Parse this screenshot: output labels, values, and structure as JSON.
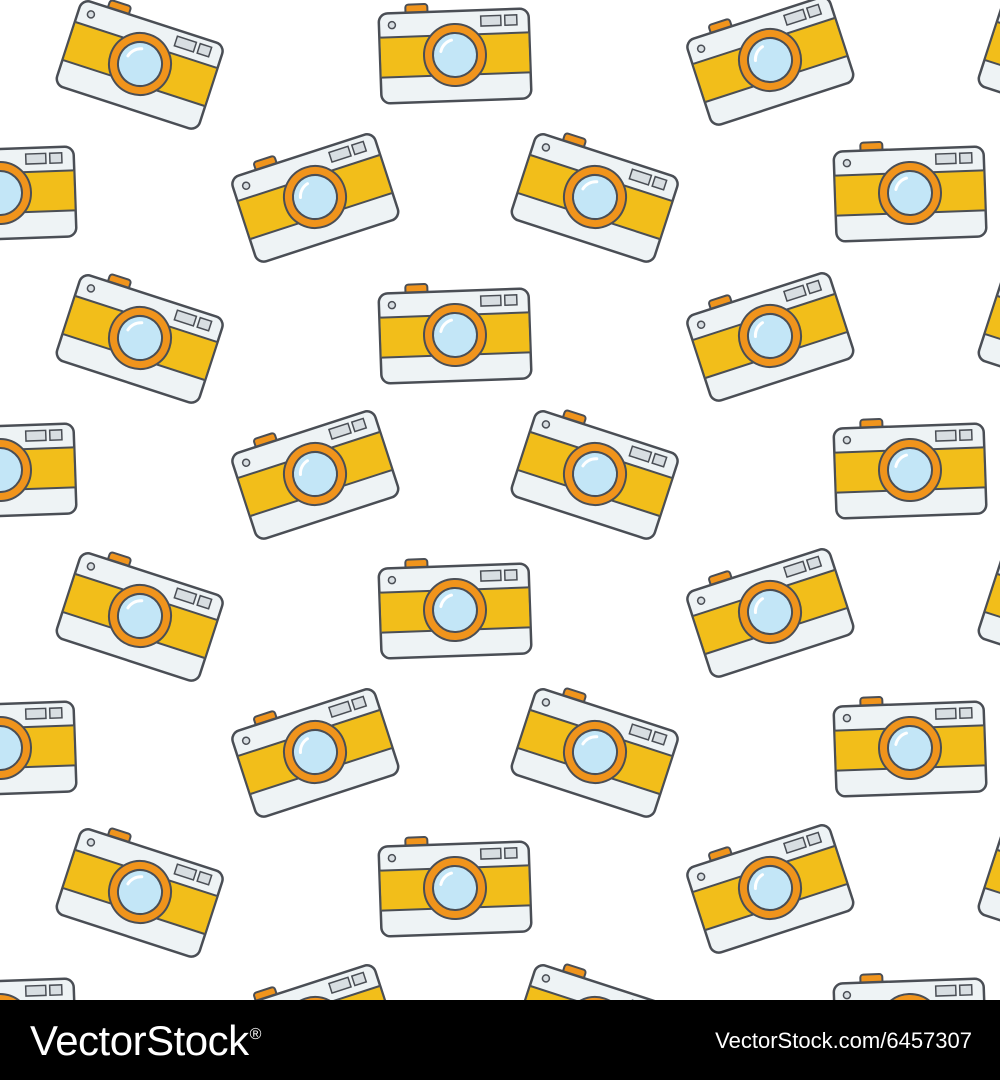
{
  "pattern": {
    "motif": "camera-icon",
    "background": "#ffffff",
    "colors": {
      "body": "#eef3f5",
      "band": "#f2be1a",
      "outline": "#4a4e55",
      "ring": "#f0941c",
      "lens": "#c3e6f7",
      "highlight": "#ffffff",
      "button": "#f0941c",
      "viewfinder": "#d8dee2"
    }
  },
  "footer": {
    "brand": "VectorStock",
    "registered": "®",
    "credit": "VectorStock.com/6457307"
  }
}
